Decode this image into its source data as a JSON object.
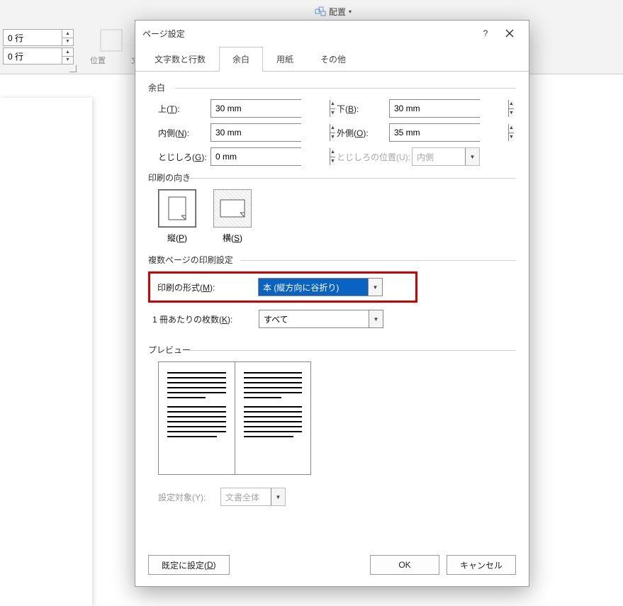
{
  "ribbon": {
    "spin1": "0 行",
    "spin2": "0 行",
    "position_label": "位置",
    "wrap_label": "文",
    "arrange_label": "配置"
  },
  "dialog": {
    "title": "ページ設定",
    "tabs": {
      "t1": "文字数と行数",
      "t2": "余白",
      "t3": "用紙",
      "t4": "その他"
    },
    "margins": {
      "header": "余白",
      "top_label": "上(T):",
      "top_value": "30 mm",
      "bottom_label": "下(B):",
      "bottom_value": "30 mm",
      "inside_label": "内側(N):",
      "inside_value": "30 mm",
      "outside_label": "外側(O):",
      "outside_value": "35 mm",
      "gutter_label": "とじしろ(G):",
      "gutter_value": "0 mm",
      "gutterpos_label": "とじしろの位置(U):",
      "gutterpos_value": "内側"
    },
    "orientation": {
      "header": "印刷の向き",
      "portrait": "縦(P)",
      "landscape": "横(S)"
    },
    "multipage": {
      "header": "複数ページの印刷設定",
      "format_label": "印刷の形式(M):",
      "format_value": "本 (縦方向に谷折り)",
      "sheets_label": "1 冊あたりの枚数(K):",
      "sheets_value": "すべて"
    },
    "preview": {
      "header": "プレビュー"
    },
    "apply": {
      "label": "設定対象(Y):",
      "value": "文書全体"
    },
    "buttons": {
      "default": "既定に設定(D)",
      "ok": "OK",
      "cancel": "キャンセル"
    }
  }
}
